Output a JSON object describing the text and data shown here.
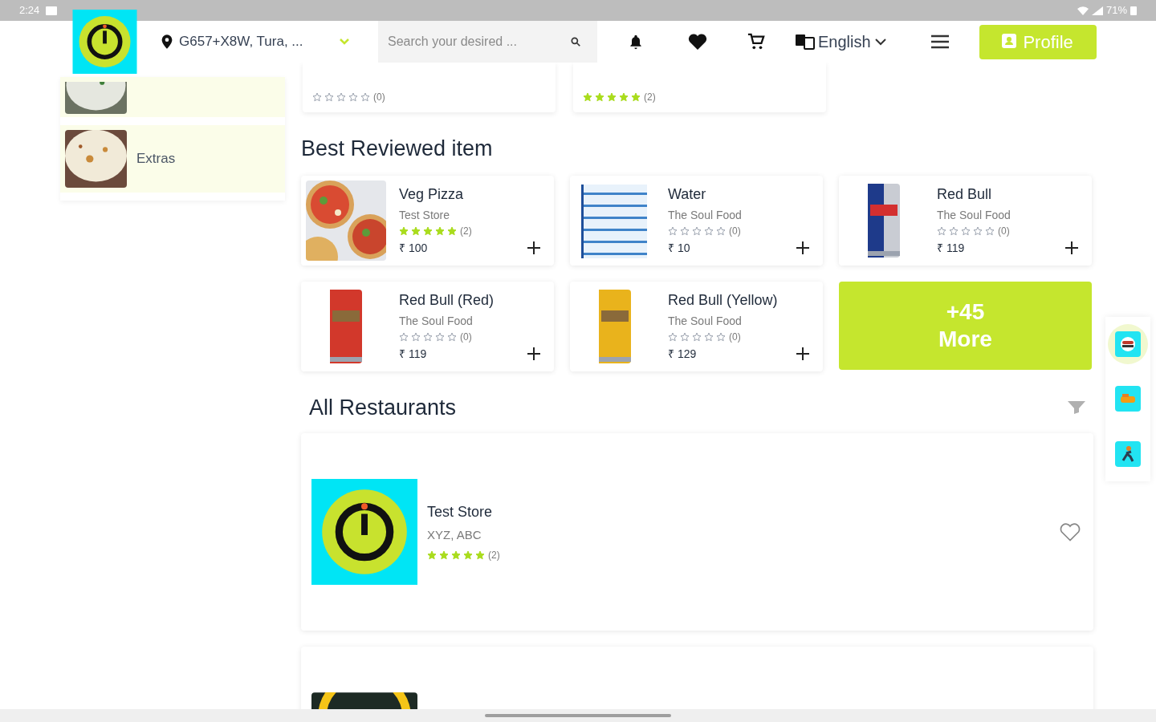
{
  "status_bar": {
    "time": "2:24",
    "battery": "71%"
  },
  "header": {
    "location": "G657+X8W, Tura, ...",
    "search": {
      "placeholder": "Search your desired ..."
    },
    "language": "English",
    "profile_button": "Profile"
  },
  "sidebar": {
    "categories": [
      {
        "kind": "cut"
      },
      {
        "kind": "full",
        "label": "Extras"
      }
    ]
  },
  "top_cards": [
    {
      "stars": 0,
      "count": "(0)"
    },
    {
      "stars": 5,
      "count": "(2)"
    }
  ],
  "best_reviewed": {
    "title": "Best Reviewed item",
    "items": [
      {
        "name": "Veg Pizza",
        "store": "Test Store",
        "stars": 5,
        "count": "(2)",
        "price": "₹ 100"
      },
      {
        "name": "Water",
        "store": "The Soul Food",
        "stars": 0,
        "count": "(0)",
        "price": "₹ 10"
      },
      {
        "name": "Red Bull",
        "store": "The Soul Food",
        "stars": 0,
        "count": "(0)",
        "price": "₹ 119"
      },
      {
        "name": "Red Bull (Red)",
        "store": "The Soul Food",
        "stars": 0,
        "count": "(0)",
        "price": "₹ 119"
      },
      {
        "name": "Red Bull (Yellow)",
        "store": "The Soul Food",
        "stars": 0,
        "count": "(0)",
        "price": "₹ 129"
      }
    ],
    "more": {
      "count": "+45",
      "label": "More"
    }
  },
  "restaurants": {
    "title": "All Restaurants",
    "items": [
      {
        "kind": "full",
        "name": "Test Store",
        "address": "XYZ, ABC",
        "stars": 5,
        "count": "(2)",
        "favorite": false
      },
      {
        "kind": "cut"
      }
    ]
  },
  "side_rail": [
    {
      "selected": true
    },
    {
      "selected": false
    },
    {
      "selected": false
    }
  ]
}
